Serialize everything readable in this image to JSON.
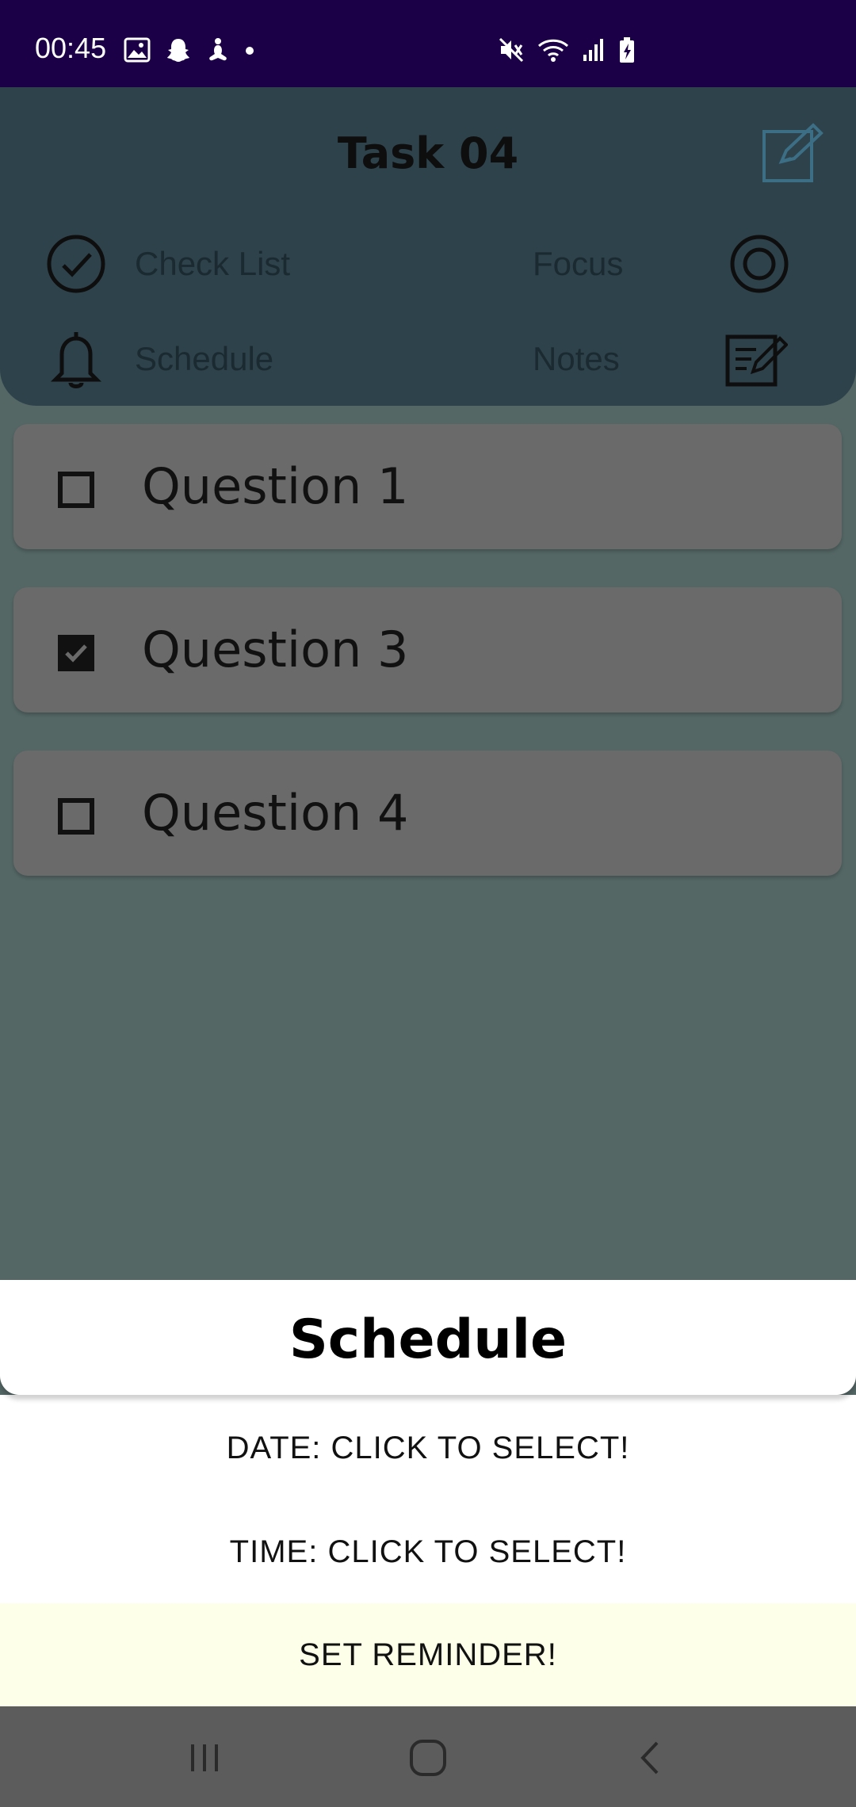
{
  "status_bar": {
    "time": "00:45",
    "left_icons": [
      "image-icon",
      "snapchat-icon",
      "meditation-icon",
      "dot-icon"
    ],
    "right_icons": [
      "mute-icon",
      "wifi-icon",
      "signal-icon",
      "battery-icon"
    ]
  },
  "header": {
    "title": "Task 04",
    "edit_icon": "edit-icon",
    "menu": {
      "check_list": "Check List",
      "focus": "Focus",
      "schedule": "Schedule",
      "notes": "Notes"
    }
  },
  "questions": [
    {
      "label": "Question 1",
      "checked": false
    },
    {
      "label": "Question 3",
      "checked": true
    },
    {
      "label": "Question 4",
      "checked": false
    }
  ],
  "sheet": {
    "title": "Schedule",
    "date_label": "DATE: CLICK TO SELECT!",
    "time_label": "TIME: CLICK TO SELECT!",
    "reminder_label": "SET REMINDER!"
  },
  "nav": [
    "recent-apps-icon",
    "home-icon",
    "back-icon"
  ],
  "colors": {
    "status_bar": "#1c0047",
    "header": "#2e424b",
    "background": "#546765",
    "card": "#6a6a6a",
    "reminder_bg": "#fdffe8",
    "nav_bar": "#5c5c5c"
  }
}
